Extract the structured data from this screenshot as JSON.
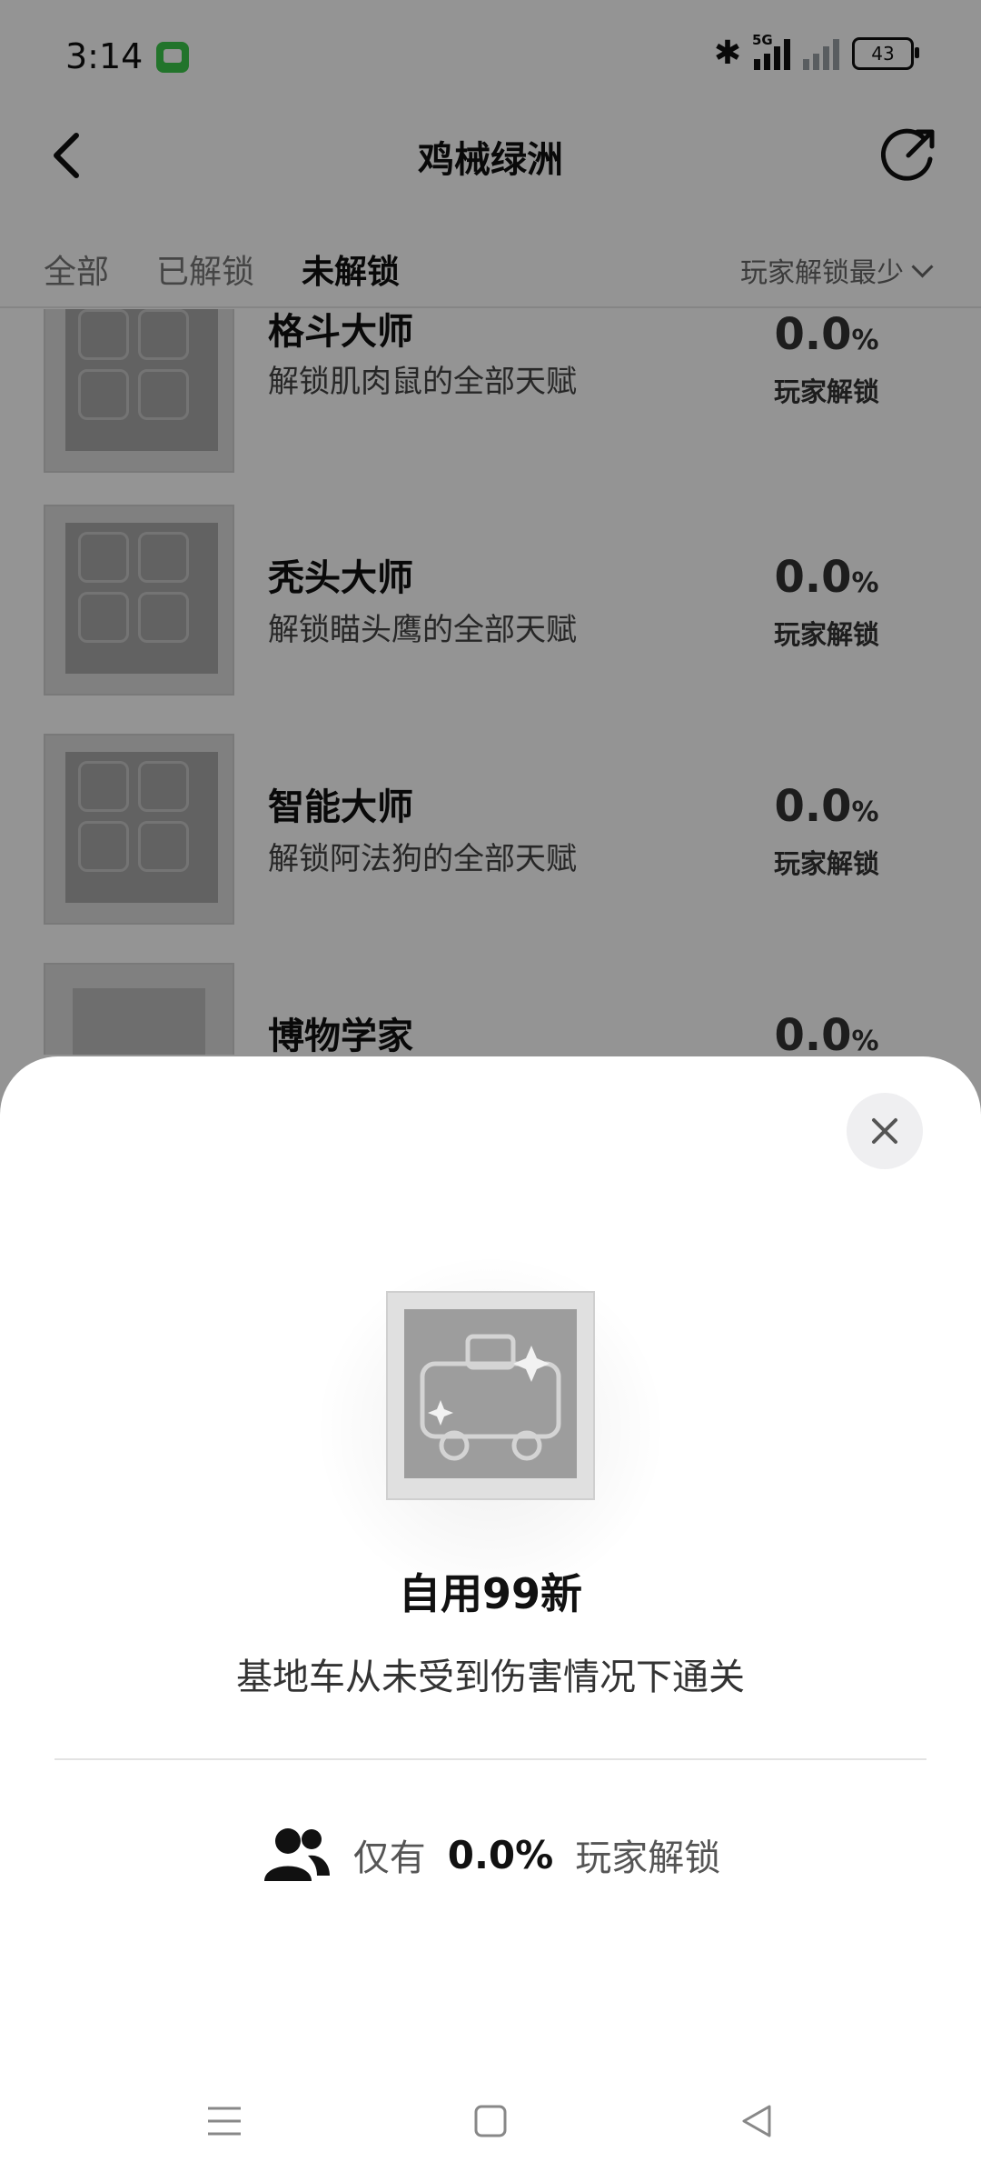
{
  "status_bar": {
    "time": "3:14",
    "network": "5G",
    "battery": "43"
  },
  "header": {
    "title": "鸡械绿洲"
  },
  "tabs": [
    {
      "label": "全部",
      "active": false
    },
    {
      "label": "已解锁",
      "active": false
    },
    {
      "label": "未解锁",
      "active": true
    }
  ],
  "sort": {
    "label": "玩家解锁最少"
  },
  "achievements": [
    {
      "name": "格斗大师",
      "desc": "解锁肌肉鼠的全部天赋",
      "pct": "0.0",
      "pct_unit": "%",
      "pct_label": "玩家解锁"
    },
    {
      "name": "秃头大师",
      "desc": "解锁瞄头鹰的全部天赋",
      "pct": "0.0",
      "pct_unit": "%",
      "pct_label": "玩家解锁"
    },
    {
      "name": "智能大师",
      "desc": "解锁阿法狗的全部天赋",
      "pct": "0.0",
      "pct_unit": "%",
      "pct_label": "玩家解锁"
    },
    {
      "name": "博物学家",
      "desc": "",
      "pct": "0.0",
      "pct_unit": "%",
      "pct_label": ""
    }
  ],
  "detail_sheet": {
    "title": "自用99新",
    "desc": "基地车从未受到伤害情况下通关",
    "stat_prefix": "仅有",
    "stat_value": "0.0%",
    "stat_suffix": "玩家解锁"
  },
  "colors": {
    "accent_text": "#111111",
    "overlay": "rgba(0,0,0,0.42)",
    "signal_green": "#3cc94a"
  }
}
